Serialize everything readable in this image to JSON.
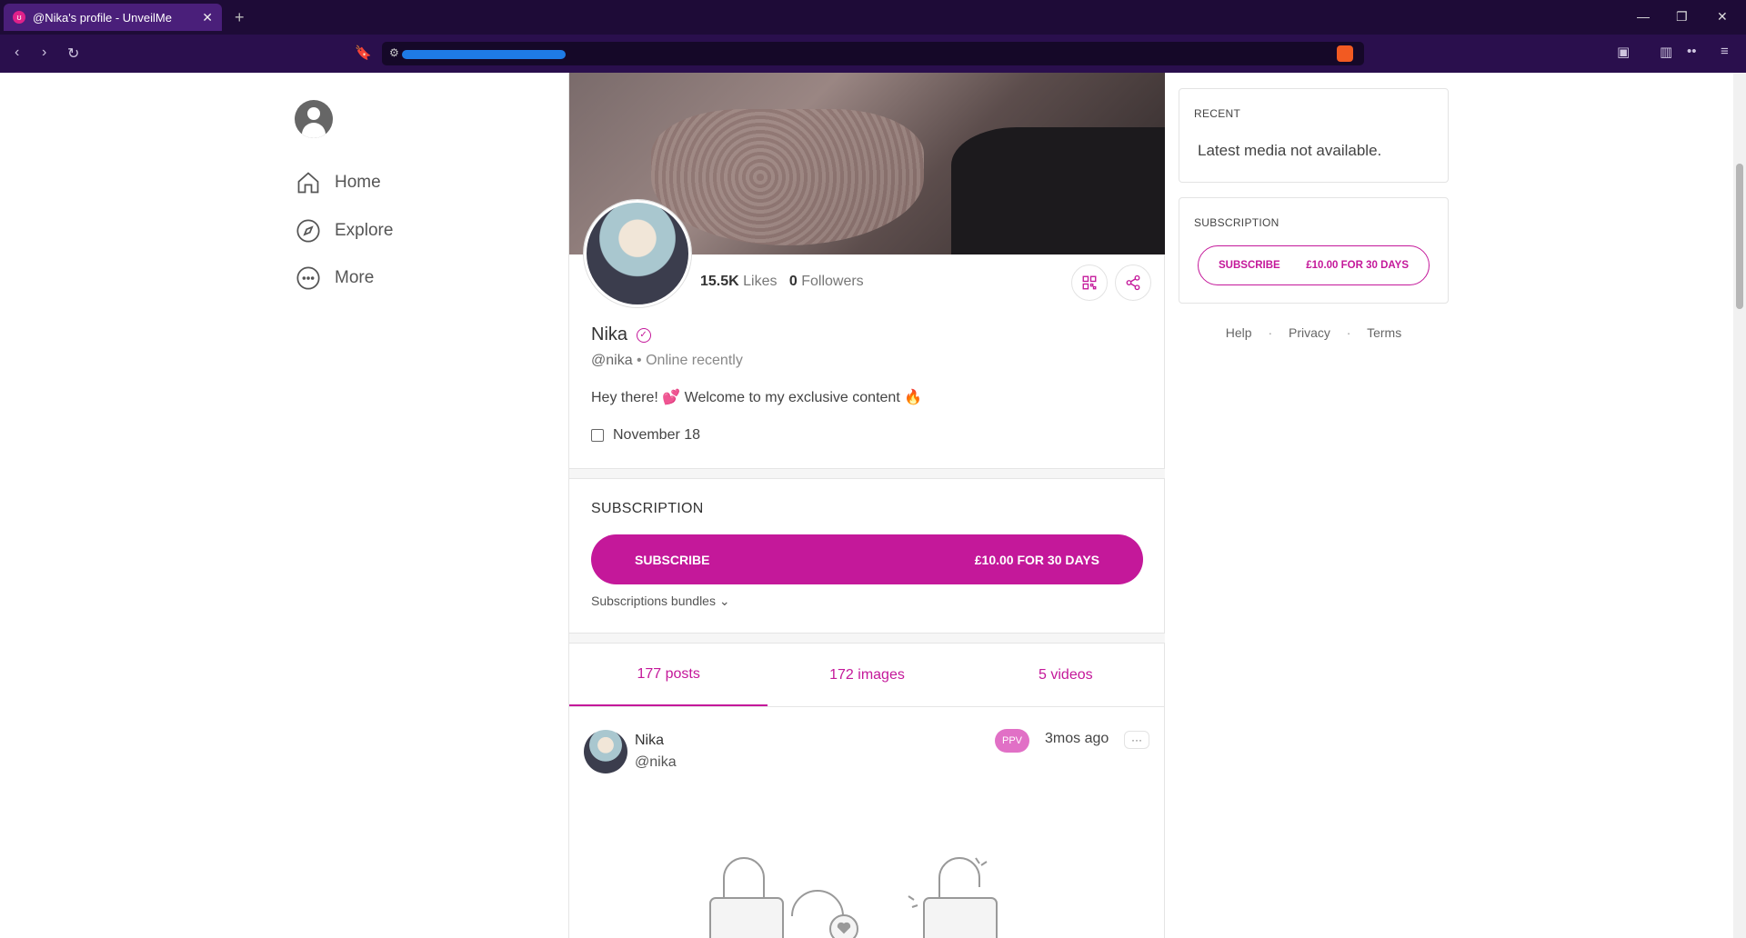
{
  "browser": {
    "tab_title": "@Nika's profile - UnveilMe"
  },
  "nav": {
    "items": [
      {
        "label": "Home",
        "icon": "home-icon"
      },
      {
        "label": "Explore",
        "icon": "compass-icon"
      },
      {
        "label": "More",
        "icon": "more-icon"
      }
    ]
  },
  "profile": {
    "likes_count": "15.5K",
    "likes_label": "Likes",
    "followers_count": "0",
    "followers_label": "Followers",
    "name": "Nika",
    "handle": "@nika",
    "status": "• Online recently",
    "bio": "Hey there! 💕 Welcome to my exclusive content 🔥",
    "joined_date": "November 18"
  },
  "subscription": {
    "title": "SUBSCRIPTION",
    "button_label": "SUBSCRIBE",
    "price_label": "£10.00 FOR 30 DAYS",
    "bundles_label": "Subscriptions bundles"
  },
  "tabs": [
    {
      "label": "177 posts",
      "active": true
    },
    {
      "label": "172 images",
      "active": false
    },
    {
      "label": "5 videos",
      "active": false
    }
  ],
  "post": {
    "author": "Nika",
    "handle": "@nika",
    "badge": "PPV",
    "time": "3mos ago",
    "more": "···"
  },
  "sidebar": {
    "recent_title": "RECENT",
    "recent_text": "Latest media not available.",
    "subscription_title": "SUBSCRIPTION",
    "subscribe_label": "SUBSCRIBE",
    "price_label": "£10.00 FOR 30 DAYS"
  },
  "footer": {
    "links": [
      "Help",
      "Privacy",
      "Terms"
    ]
  },
  "colors": {
    "accent": "#c4189a",
    "browser_bg": "#1e0b37"
  }
}
